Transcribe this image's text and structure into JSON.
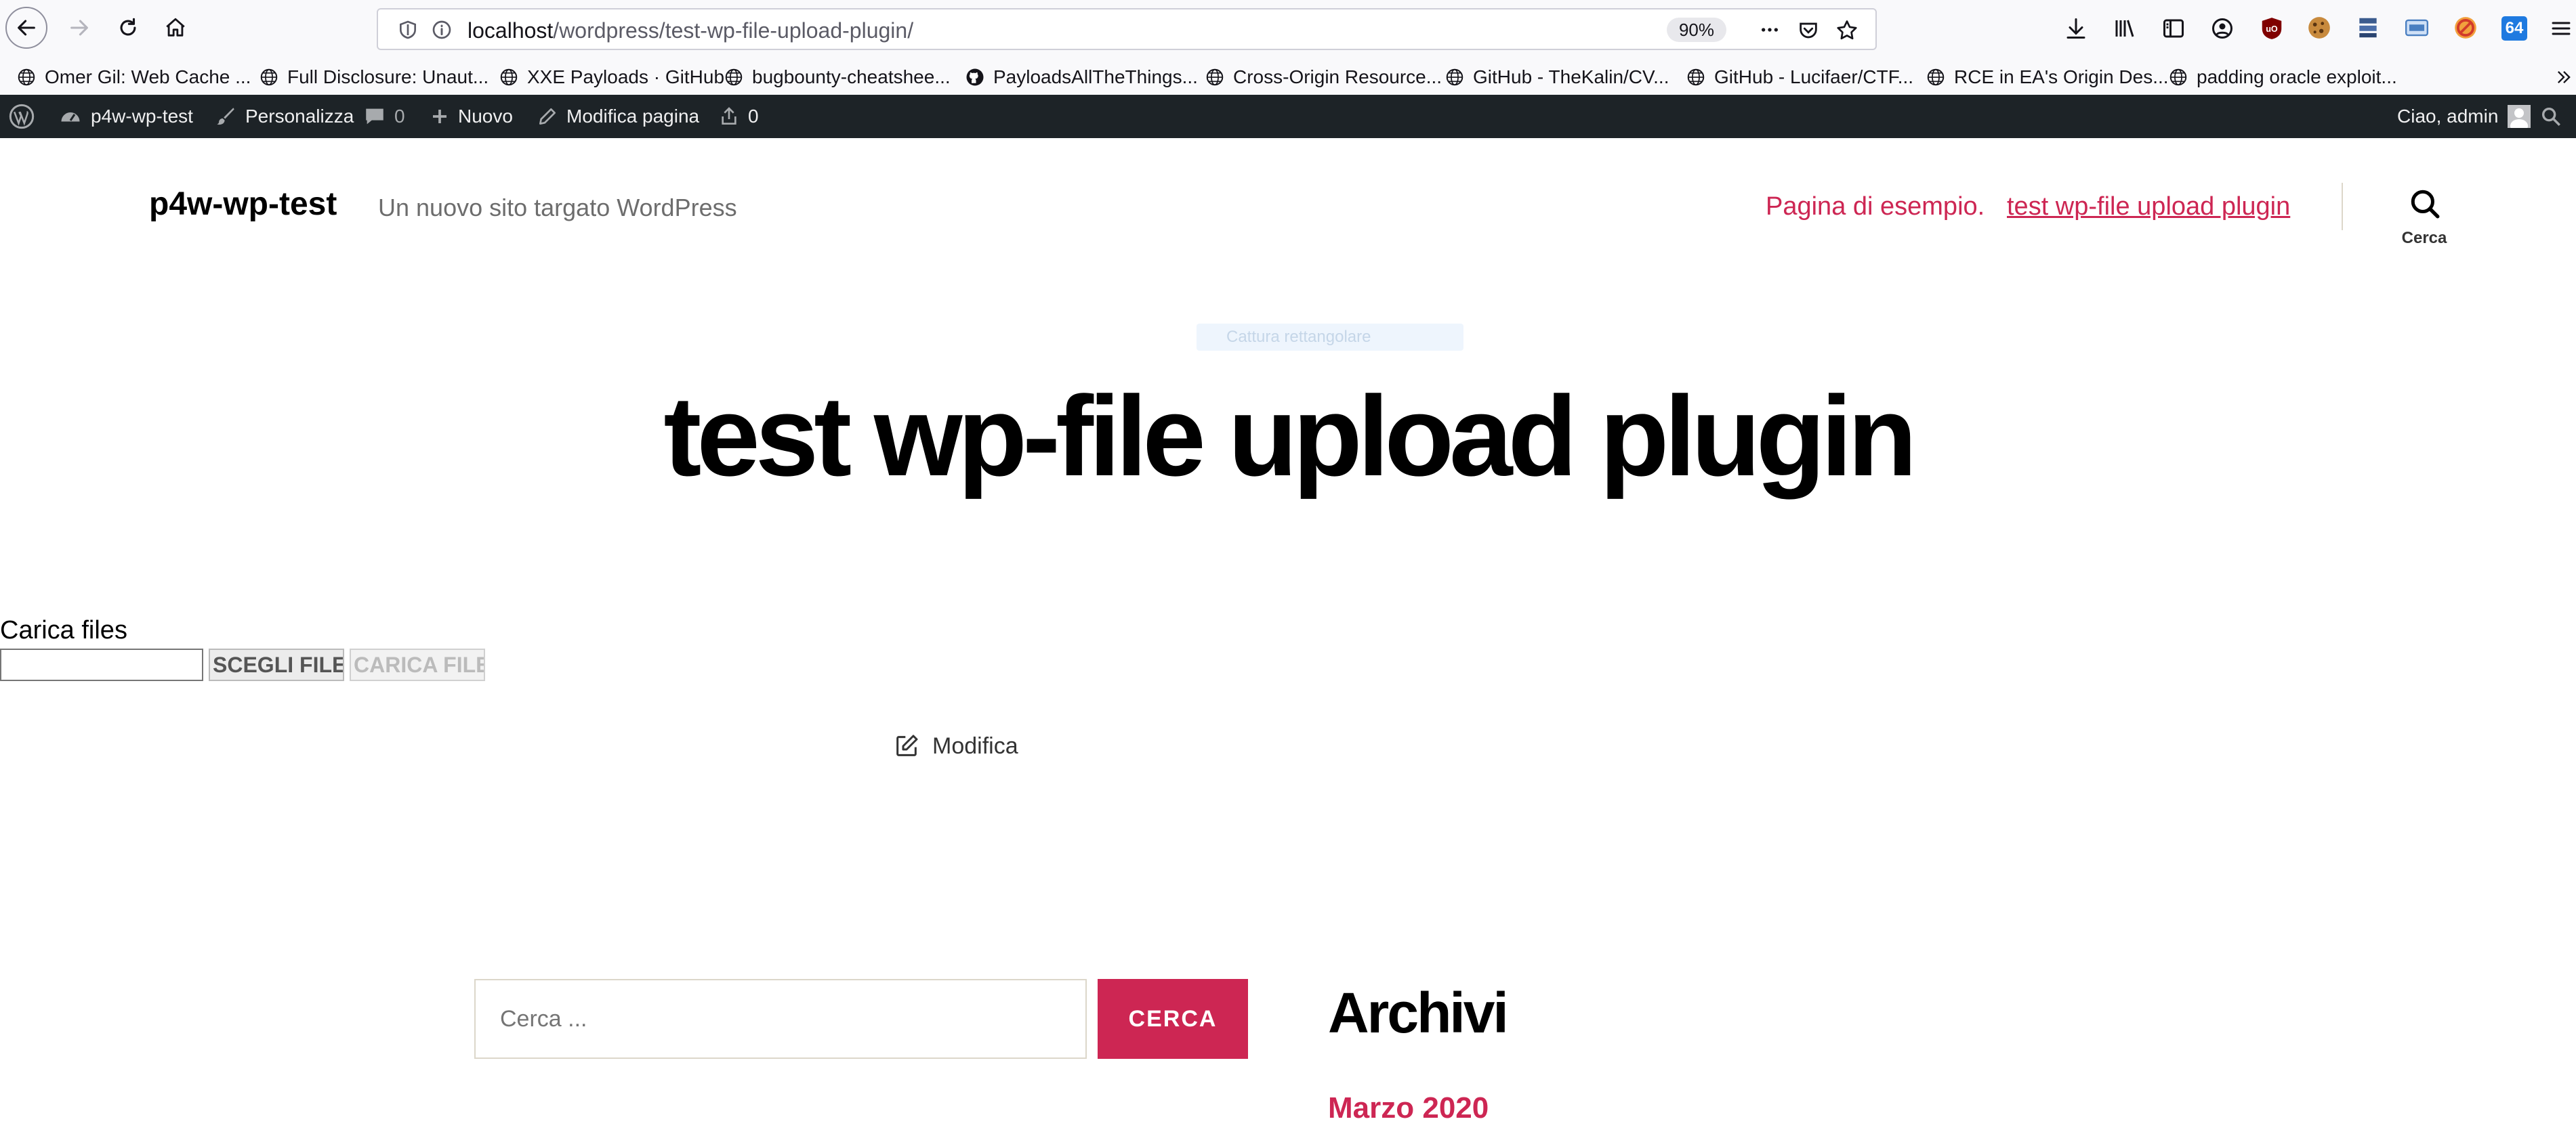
{
  "browser": {
    "url_host": "localhost",
    "url_path": "/wordpress/test-wp-file-upload-plugin/",
    "zoom": "90%",
    "bookmarks": [
      {
        "label": "Omer Gil: Web Cache ...",
        "icon": "globe-icon"
      },
      {
        "label": "Full Disclosure: Unaut...",
        "icon": "globe-icon"
      },
      {
        "label": "XXE Payloads · GitHub",
        "icon": "globe-icon"
      },
      {
        "label": "bugbounty-cheatshee...",
        "icon": "globe-icon"
      },
      {
        "label": "PayloadsAllTheThings...",
        "icon": "github-icon"
      },
      {
        "label": "Cross-Origin Resource...",
        "icon": "globe-icon"
      },
      {
        "label": "GitHub - TheKalin/CV...",
        "icon": "globe-icon"
      },
      {
        "label": "GitHub - Lucifaer/CTF...",
        "icon": "globe-icon"
      },
      {
        "label": "RCE in EA's Origin Des...",
        "icon": "globe-icon"
      },
      {
        "label": "padding oracle exploit...",
        "icon": "globe-icon"
      }
    ],
    "ext_badge": "64"
  },
  "adminbar": {
    "site": "p4w-wp-test",
    "customize": "Personalizza",
    "comments_count": "0",
    "new": "Nuovo",
    "edit_page": "Modifica pagina",
    "updates_count": "0",
    "greeting": "Ciao, admin"
  },
  "site": {
    "title": "p4w-wp-test",
    "description": "Un nuovo sito targato WordPress",
    "menu": [
      "Pagina di esempio.",
      "test wp-file upload plugin"
    ],
    "search_toggle_label": "Cerca",
    "accent_color": "#cd2653"
  },
  "content": {
    "overlay_text": "Cattura rettangolare",
    "title": "test wp-file upload plugin",
    "upload_label": "Carica files",
    "choose_button": "SCEGLI FILE",
    "upload_button": "CARICA FILE",
    "edit_link": "Modifica"
  },
  "widgets": {
    "search_placeholder": "Cerca ...",
    "search_button": "CERCA",
    "archive_title": "Archivi",
    "archive_items": [
      "Marzo 2020"
    ]
  }
}
